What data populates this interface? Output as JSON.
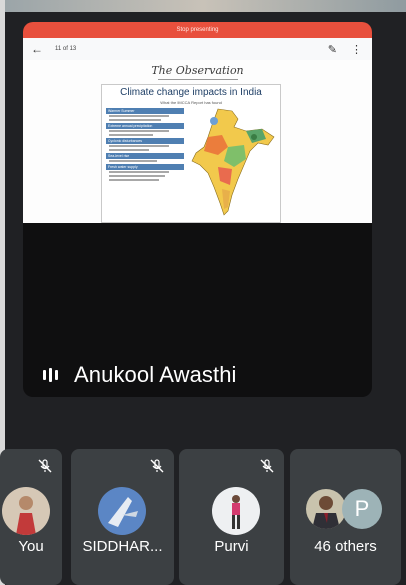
{
  "presentation": {
    "banner": "Stop presenting",
    "page_indicator": "11 of 13",
    "slide_title": "The Observation",
    "card_title": "Climate change impacts in India",
    "card_subtitle": "What the IMCCA Report has found",
    "sections": [
      "Warmer Summer",
      "Extreme annual precipitation",
      "Cyclonic disturbances",
      "Sea-level rise",
      "Fresh water supply"
    ]
  },
  "main_speaker": {
    "name": "Anukool Awasthi"
  },
  "participants": [
    {
      "label": "You",
      "muted": true
    },
    {
      "label": "SIDDHAR...",
      "muted": true
    },
    {
      "label": "Purvi",
      "muted": true
    },
    {
      "label": "46 others",
      "initial": "P"
    }
  ],
  "colors": {
    "stage": "#202124",
    "tile": "#3c4043",
    "banner": "#e8503d",
    "section": "#4f7fb2"
  }
}
